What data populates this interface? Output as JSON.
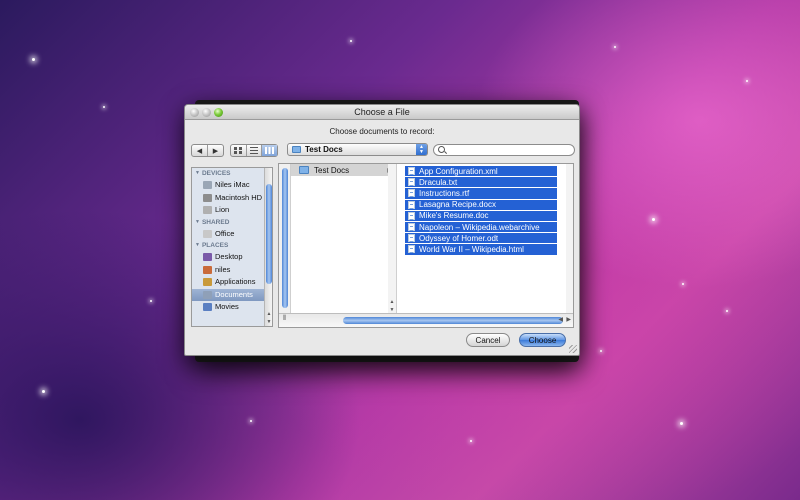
{
  "dialog": {
    "title": "Choose a File",
    "prompt": "Choose documents to record:"
  },
  "toolbar": {
    "back_label": "◀",
    "forward_label": "▶",
    "current_folder": "Test Docs",
    "search_value": ""
  },
  "sidebar": {
    "sections": [
      {
        "heading": "DEVICES",
        "items": [
          {
            "label": "Niles iMac",
            "icon": "computer-icon"
          },
          {
            "label": "Macintosh HD",
            "icon": "hard-drive-icon"
          },
          {
            "label": "Lion",
            "icon": "disk-icon"
          }
        ]
      },
      {
        "heading": "SHARED",
        "items": [
          {
            "label": "Office",
            "icon": "network-computer-icon"
          }
        ]
      },
      {
        "heading": "PLACES",
        "items": [
          {
            "label": "Desktop",
            "icon": "desktop-icon"
          },
          {
            "label": "niles",
            "icon": "home-icon"
          },
          {
            "label": "Applications",
            "icon": "applications-icon"
          },
          {
            "label": "Documents",
            "icon": "documents-icon",
            "selected": true
          },
          {
            "label": "Movies",
            "icon": "movies-icon"
          }
        ]
      }
    ]
  },
  "browser": {
    "column1": [
      {
        "label": "Test Docs",
        "icon": "folder-icon"
      }
    ],
    "files": [
      "App Configuration.xml",
      "Dracula.txt",
      "Instructions.rtf",
      "Lasagna Recipe.docx",
      "Mike's Resume.doc",
      "Napoleon – Wikipedia.webarchive",
      "Odyssey of Homer.odt",
      "World War II – Wikipedia.html"
    ]
  },
  "buttons": {
    "cancel_label": "Cancel",
    "choose_label": "Choose"
  },
  "colors": {
    "selection": "#2461d4",
    "sidebar_bg": "#dde4ee",
    "default_button": "#5f95e3"
  }
}
